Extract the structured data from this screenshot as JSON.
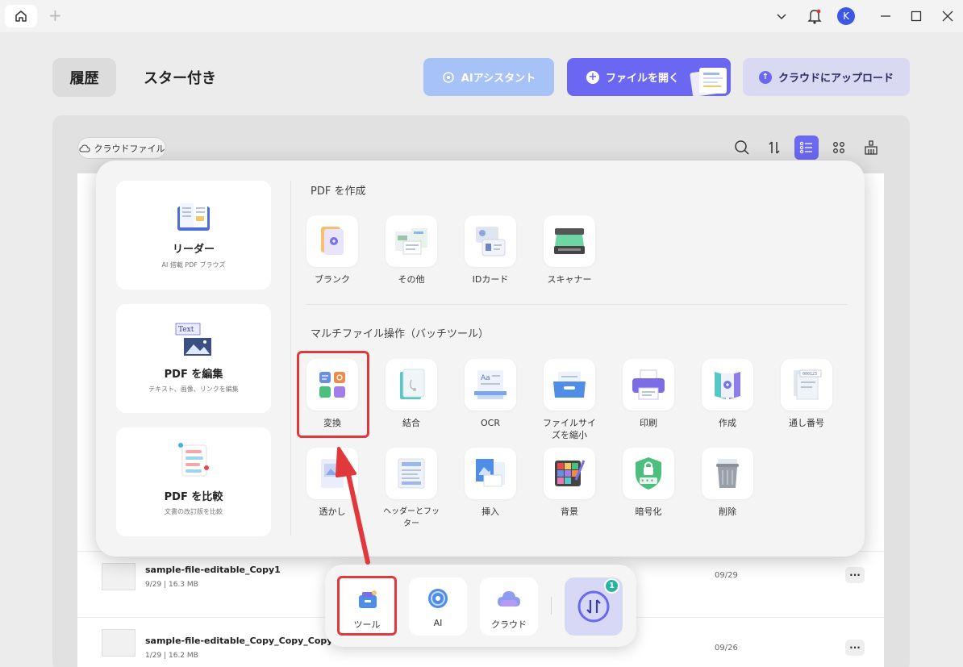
{
  "titlebar": {
    "avatar_initial": "K"
  },
  "header": {
    "tab_history": "履歴",
    "tab_starred": "スター付き",
    "ai_button": "AIアシスタント",
    "open_button": "ファイルを開く",
    "upload_button": "クラウドにアップロード"
  },
  "toolbar": {
    "cloud_files": "クラウドファイル"
  },
  "popup": {
    "left_cards": [
      {
        "title": "リーダー",
        "subtitle": "AI 搭載 PDF ブラウズ"
      },
      {
        "title": "PDF を編集",
        "subtitle": "テキスト、画像、リンクを編集",
        "icon_text": "Text"
      },
      {
        "title": "PDF を比較",
        "subtitle": "文書の改訂版を比較"
      }
    ],
    "create_section": {
      "title": "PDF を作成",
      "tools": [
        "ブランク",
        "その他",
        "IDカード",
        "スキャナー"
      ]
    },
    "batch_section": {
      "title": "マルチファイル操作（バッチツール）",
      "tools_row1": [
        "変換",
        "結合",
        "OCR",
        "ファイルサイズを縮小",
        "印刷",
        "作成",
        "通し番号"
      ],
      "tools_row2": [
        "透かし",
        "ヘッダーとフッター",
        "挿入",
        "背景",
        "暗号化",
        "削除"
      ]
    }
  },
  "files": [
    {
      "name": "sample-file-editable_Copy1",
      "meta": "9/29 | 16.3 MB",
      "date": "09/29"
    },
    {
      "name": "sample-file-editable_Copy_Copy_Copy",
      "meta": "1/29 | 16.2 MB",
      "date": "09/26"
    }
  ],
  "dock": {
    "tool": "ツール",
    "ai": "AI",
    "cloud": "クラウド",
    "badge_count": "1"
  },
  "colors": {
    "accent": "#6c67f3",
    "highlight": "#e0383b",
    "ai_button": "#a7c2f6"
  }
}
